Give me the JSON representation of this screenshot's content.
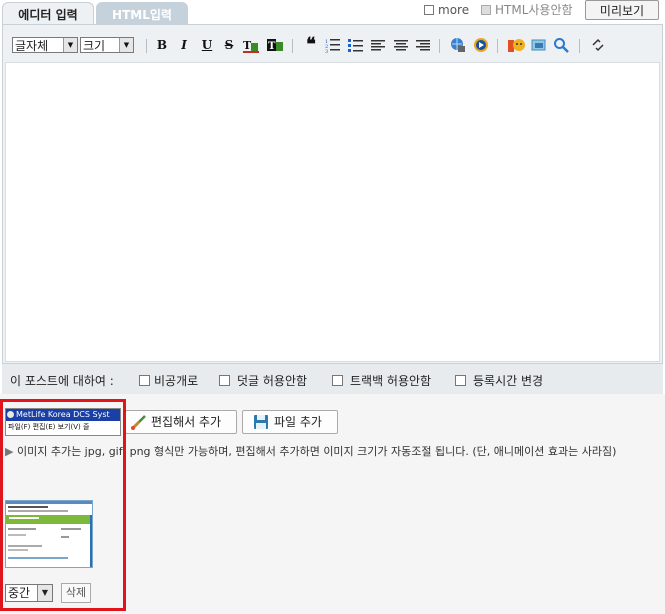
{
  "tabs": [
    {
      "label": "에디터 입력",
      "active": true
    },
    {
      "label": "HTML입력",
      "active": false
    }
  ],
  "top_options": {
    "more_label": "more",
    "html_label": "HTML사용안함",
    "preview_label": "미리보기"
  },
  "toolbar": {
    "font_select": "글자체",
    "size_select": "크기",
    "bold": "B",
    "italic": "I",
    "underline": "U",
    "strike": "S"
  },
  "post_options": {
    "label": "이 포스트에 대하여 :",
    "private": "비공개로",
    "no_comment": "덧글 허용안함",
    "no_trackback": "트랙백 허용안함",
    "change_time": "등록시간 변경"
  },
  "attach": {
    "thumb_title": "MetLife Korea DCS Syst",
    "thumb_menu": "파일(F)   편집(E)   보기(V)   즐",
    "edit_add_label": "편집해서 추가",
    "file_add_label": "파일 추가",
    "info_text": "이미지 추가는 jpg, gif, png 형식만 가능하며, 편집해서 추가하면 이미지 크기가 자동조절 됩니다. (단, 애니메이션 효과는 사라짐)",
    "size_value": "중간",
    "delete_label": "삭제"
  },
  "colors": {
    "accent_border": "#e0151b",
    "tab_inactive": "#c6d2db",
    "toolbar_bg": "#eef1f3"
  }
}
